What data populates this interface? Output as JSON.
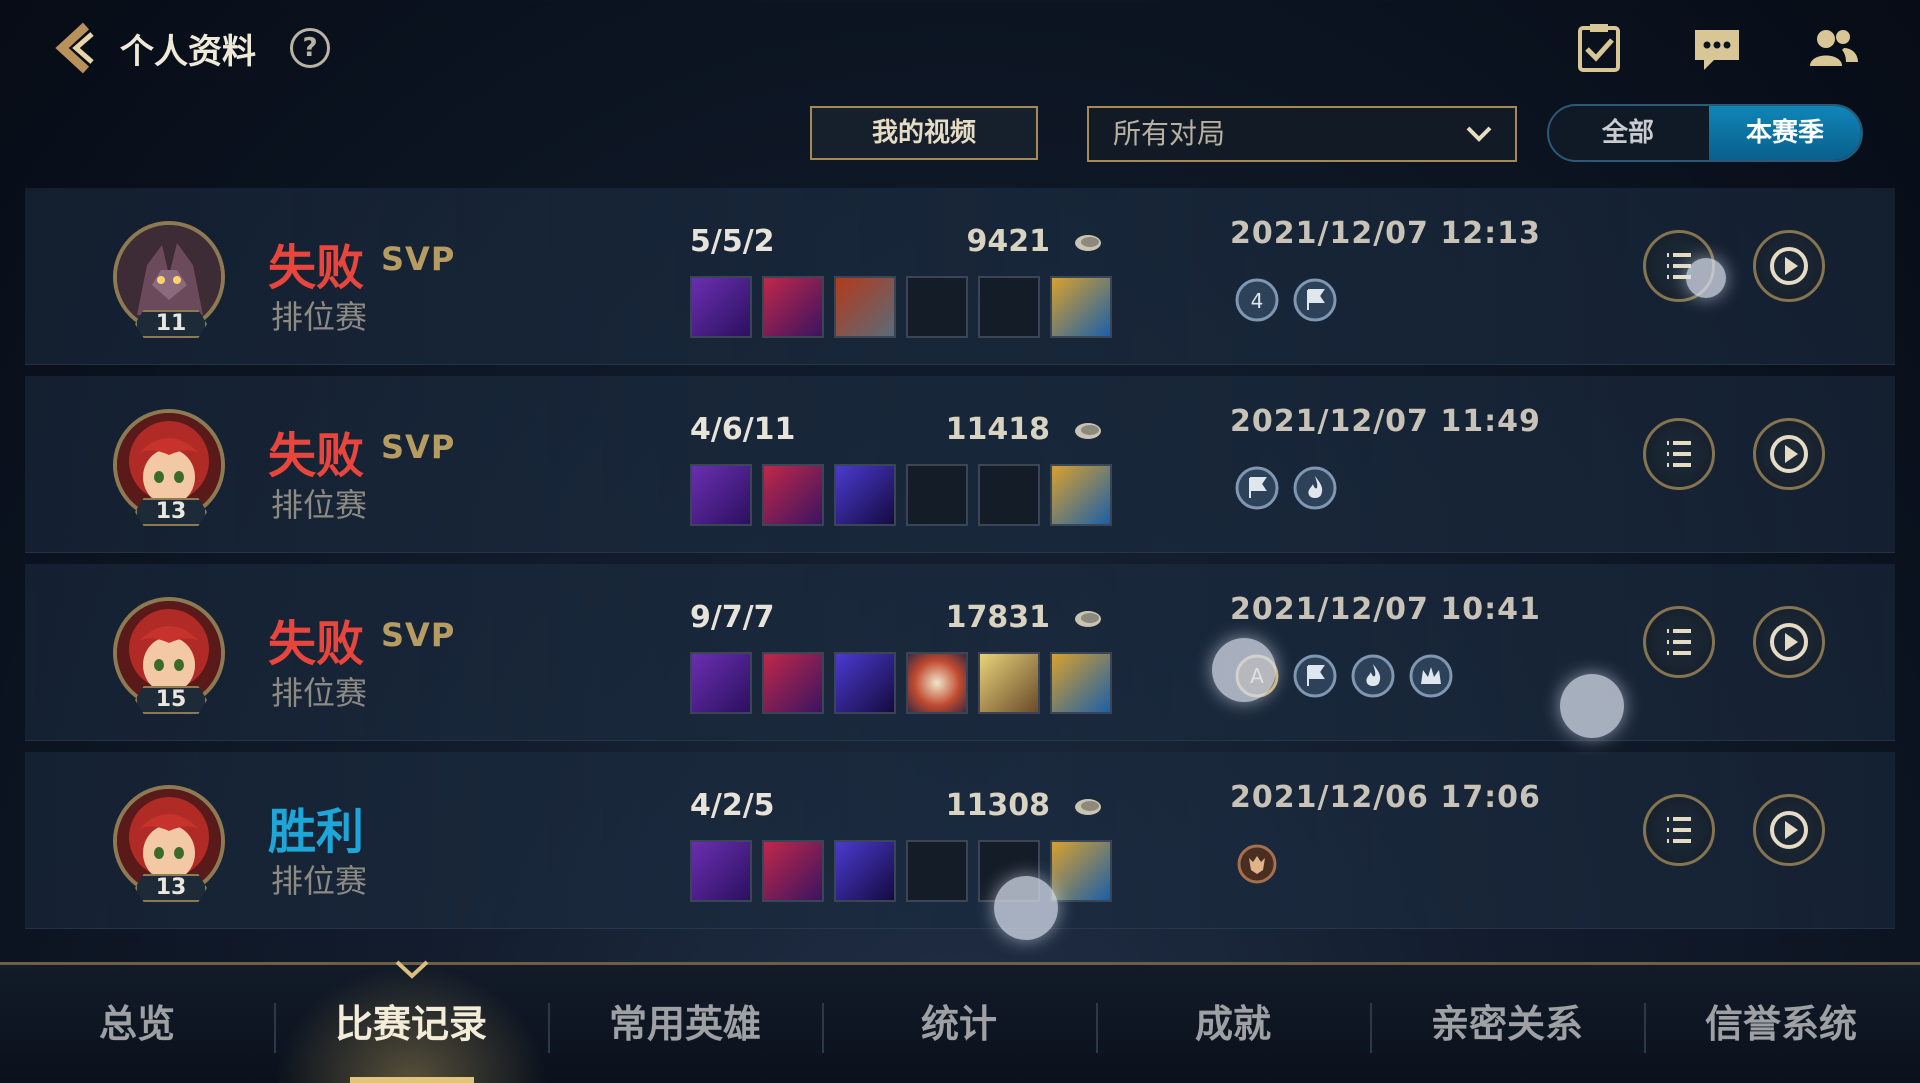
{
  "header": {
    "title": "个人资料",
    "help_label": "?"
  },
  "toolbar": {
    "my_videos_label": "我的视频",
    "match_filter": {
      "selected": "所有对局"
    },
    "segment": {
      "all_label": "全部",
      "season_label": "本赛季",
      "selected": "本赛季"
    }
  },
  "matches": [
    {
      "level": "11",
      "result": "失败",
      "result_type": "lose",
      "svp": "SVP",
      "mode": "排位赛",
      "kda": "5/5/2",
      "gold": "9421",
      "date": "2021/12/07 12:13",
      "items_filled": 4,
      "badges": [
        "4-icon",
        "flag-icon"
      ],
      "champion_icon": "dark-champion-avatar"
    },
    {
      "level": "13",
      "result": "失败",
      "result_type": "lose",
      "svp": "SVP",
      "mode": "排位赛",
      "kda": "4/6/11",
      "gold": "11418",
      "date": "2021/12/07 11:49",
      "items_filled": 4,
      "badges": [
        "flag-icon",
        "flame-icon"
      ],
      "champion_icon": "red-hair-champion-avatar"
    },
    {
      "level": "15",
      "result": "失败",
      "result_type": "lose",
      "svp": "SVP",
      "mode": "排位赛",
      "kda": "9/7/7",
      "gold": "17831",
      "date": "2021/12/07 10:41",
      "items_filled": 6,
      "badges": [
        "a-icon",
        "flag-icon",
        "flame-icon",
        "crown-icon"
      ],
      "champion_icon": "red-hair-champion-avatar"
    },
    {
      "level": "13",
      "result": "胜利",
      "result_type": "win",
      "svp": "",
      "mode": "排位赛",
      "kda": "4/2/5",
      "gold": "11308",
      "date": "2021/12/06 17:06",
      "items_filled": 4,
      "badges": [
        "demon-icon"
      ],
      "champion_icon": "red-hair-champion-avatar"
    }
  ],
  "tabs": [
    {
      "label": "总览"
    },
    {
      "label": "比赛记录"
    },
    {
      "label": "常用英雄"
    },
    {
      "label": "统计"
    },
    {
      "label": "成就"
    },
    {
      "label": "亲密关系"
    },
    {
      "label": "信誉系统"
    }
  ],
  "active_tab": "比赛记录",
  "colors": {
    "lose": "#e8453c",
    "win": "#1ea6d8",
    "accent_gold": "#a68a56",
    "season_blue": "#0f86b8"
  }
}
